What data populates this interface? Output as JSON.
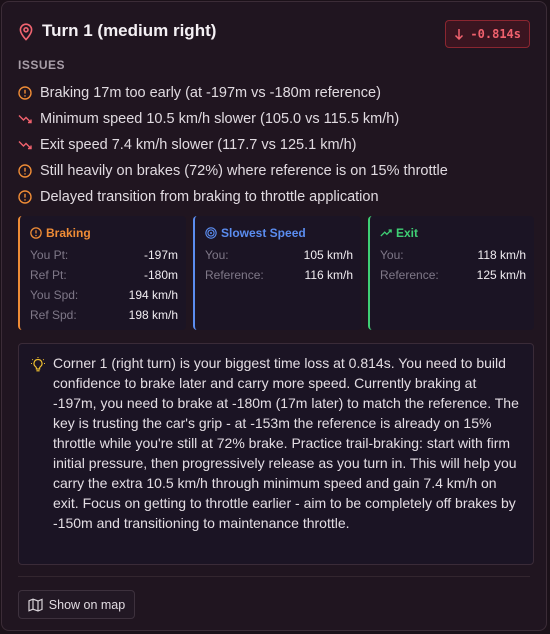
{
  "header": {
    "title": "Turn 1 (medium right)",
    "delta": "-0.814s"
  },
  "issues_label": "ISSUES",
  "issues": [
    {
      "icon": "alert-circle-icon",
      "text": "Braking 17m too early (at -197m vs -180m reference)"
    },
    {
      "icon": "trending-down-icon",
      "text": "Minimum speed 10.5 km/h slower (105.0 vs 115.5 km/h)"
    },
    {
      "icon": "trending-down-icon",
      "text": "Exit speed 7.4 km/h slower (117.7 vs 125.1 km/h)"
    },
    {
      "icon": "alert-circle-icon",
      "text": "Still heavily on brakes (72%) where reference is on 15% throttle"
    },
    {
      "icon": "alert-circle-icon",
      "text": "Delayed transition from braking to throttle application"
    }
  ],
  "panels": {
    "braking": {
      "title": "Braking",
      "rows": [
        {
          "k": "You Pt:",
          "v": "-197m"
        },
        {
          "k": "Ref Pt:",
          "v": "-180m"
        },
        {
          "k": "You Spd:",
          "v": "194 km/h"
        },
        {
          "k": "Ref Spd:",
          "v": "198 km/h"
        }
      ]
    },
    "slowest": {
      "title": "Slowest Speed",
      "rows": [
        {
          "k": "You:",
          "v": "105 km/h"
        },
        {
          "k": "Reference:",
          "v": "116 km/h"
        }
      ]
    },
    "exit": {
      "title": "Exit",
      "rows": [
        {
          "k": "You:",
          "v": "118 km/h"
        },
        {
          "k": "Reference:",
          "v": "125 km/h"
        }
      ]
    }
  },
  "coaching": "Corner 1 (right turn) is your biggest time loss at 0.814s. You need to build confidence to brake later and carry more speed. Currently braking at -197m, you need to brake at -180m (17m later) to match the reference. The key is trusting the car's grip - at -153m the reference is already on 15% throttle while you're still at 72% brake. Practice trail-braking: start with firm initial pressure, then progressively release as you turn in. This will help you carry the extra 10.5 km/h through minimum speed and gain 7.4 km/h on exit. Focus on getting to throttle earlier - aim to be completely off brakes by -150m and transitioning to maintenance throttle.",
  "map_button": "Show on map",
  "colors": {
    "accent": "#ef8c36",
    "braking": "#ef8c36",
    "slowest": "#5b8df0",
    "exit": "#3fcf74",
    "negative": "#f0616d"
  }
}
